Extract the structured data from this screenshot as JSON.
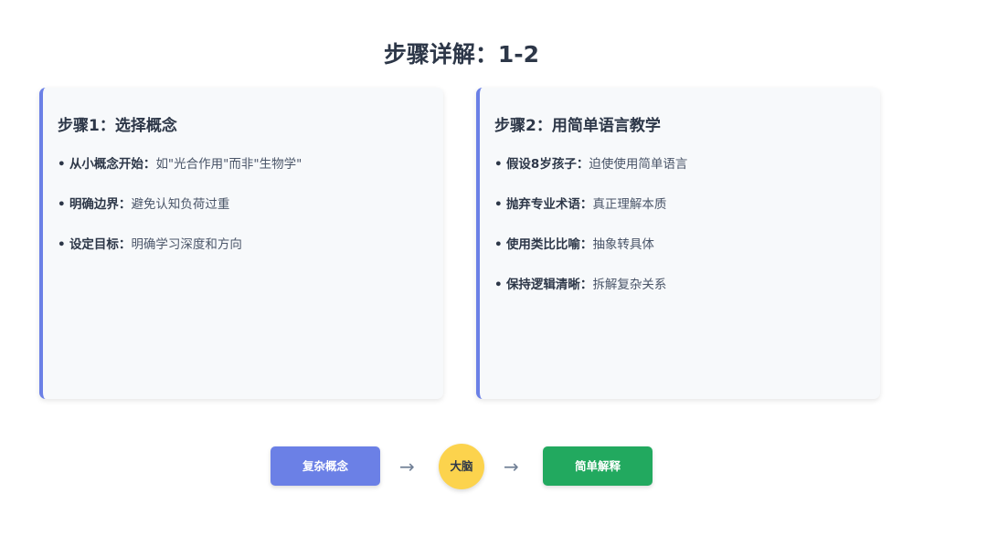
{
  "page_title": "步骤详解：1-2",
  "cards": [
    {
      "title": "步骤1：选择概念",
      "items": [
        {
          "bullet": "•",
          "key": "从小概念开始：",
          "text": "如\"光合作用\"而非\"生物学\""
        },
        {
          "bullet": "•",
          "key": "明确边界：",
          "text": "避免认知负荷过重"
        },
        {
          "bullet": "•",
          "key": "设定目标：",
          "text": "明确学习深度和方向"
        }
      ]
    },
    {
      "title": "步骤2：用简单语言教学",
      "items": [
        {
          "bullet": "•",
          "key": "假设8岁孩子：",
          "text": "迫使使用简单语言"
        },
        {
          "bullet": "•",
          "key": "抛弃专业术语：",
          "text": "真正理解本质"
        },
        {
          "bullet": "•",
          "key": "使用类比比喻：",
          "text": "抽象转具体"
        },
        {
          "bullet": "•",
          "key": "保持逻辑清晰：",
          "text": "拆解复杂关系"
        }
      ]
    }
  ],
  "flow": {
    "start_label": "复杂概念",
    "middle_label": "大脑",
    "end_label": "简单解释",
    "arrow": "→"
  },
  "colors": {
    "accent": "#6b80e6",
    "success": "#22a95f",
    "brain": "#fcd34d",
    "card_bg": "#f7f9fb"
  }
}
